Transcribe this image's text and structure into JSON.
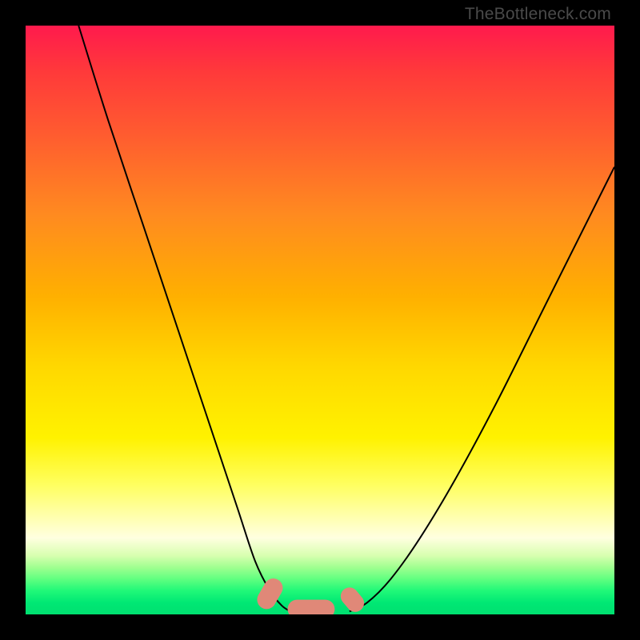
{
  "watermark": {
    "text": "TheBottleneck.com"
  },
  "chart_data": {
    "type": "line",
    "title": "",
    "xlabel": "",
    "ylabel": "",
    "xlim": [
      0,
      100
    ],
    "ylim": [
      0,
      100
    ],
    "series": [
      {
        "name": "left-curve",
        "x": [
          9,
          14,
          20,
          26,
          32,
          36,
          39,
          41.5,
          43.5,
          45
        ],
        "values": [
          100,
          84,
          66,
          48,
          30,
          18,
          9,
          4,
          1.5,
          0.5
        ]
      },
      {
        "name": "right-curve",
        "x": [
          55,
          58,
          62,
          67,
          73,
          80,
          88,
          96,
          100
        ],
        "values": [
          0.5,
          2,
          6,
          13,
          23,
          36,
          52,
          68,
          76
        ]
      }
    ],
    "markers": {
      "name": "bottom-markers",
      "color": "#e08878",
      "items": [
        {
          "shape": "capsule",
          "cx": 41.5,
          "cy": 3.5,
          "angle": -60,
          "len": 5.5,
          "r": 1.6
        },
        {
          "shape": "capsule",
          "cx": 48.5,
          "cy": 0.9,
          "angle": 0,
          "len": 8,
          "r": 1.6
        },
        {
          "shape": "capsule",
          "cx": 55.5,
          "cy": 2.5,
          "angle": 50,
          "len": 4.5,
          "r": 1.5
        }
      ]
    },
    "background_gradient": {
      "top": "#ff1a4d",
      "mid": "#ffe000",
      "bottom": "#00e070"
    }
  }
}
